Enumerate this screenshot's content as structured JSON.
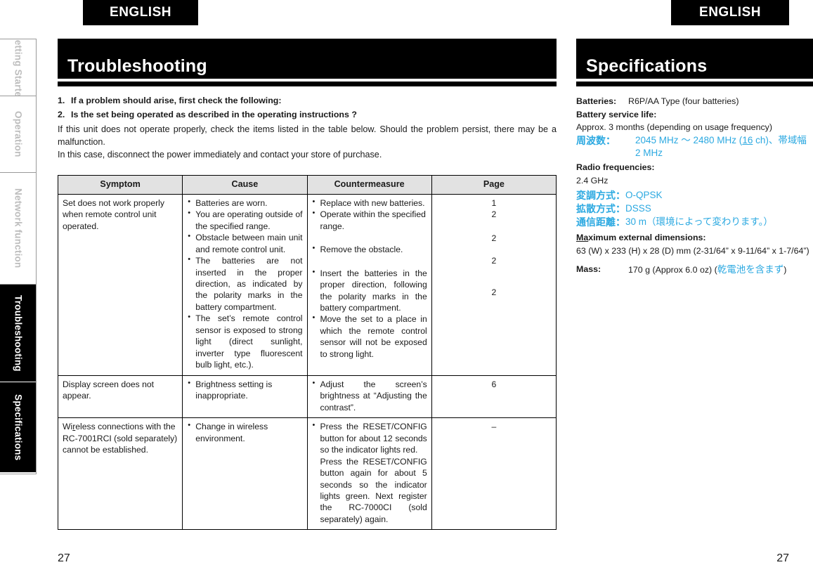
{
  "colors": {
    "accent_blue": "#2ca9e1",
    "header_bg": "#000000",
    "table_header_bg": "#e2e2e2"
  },
  "language_tabs": {
    "left": "ENGLISH",
    "right": "ENGLISH"
  },
  "sidebar": {
    "items": [
      {
        "label": "Getting Started",
        "active": false
      },
      {
        "label": "Operation",
        "active": false
      },
      {
        "label": "Network function",
        "active": false
      },
      {
        "label": "Troubleshooting",
        "active": true
      },
      {
        "label": "Specifications",
        "active": true
      }
    ]
  },
  "main": {
    "title": "Troubleshooting",
    "intro": {
      "item1_num": "1.",
      "item1": "If a problem should arise, first check the following:",
      "item2_num": "2.",
      "item2": "Is the set being operated as described in the operating instructions ?",
      "para1": "If this unit does not operate properly, check the items listed in the table below. Should the problem persist, there may be a malfunction.",
      "para2": "In this case, disconnect the power immediately and contact your store of purchase."
    },
    "table": {
      "headers": [
        "Symptom",
        "Cause",
        "Countermeasure",
        "Page"
      ],
      "rows": [
        {
          "symptom": "Set does not work properly when remote control unit operated.",
          "causes": [
            "Batteries are worn.",
            "You are operating outside of the specified range.",
            "Obstacle between main unit and remote control unit.",
            "The batteries are not inserted in the proper direction, as indicated by the polarity marks in the battery compartment.",
            "The set’s remote control sensor is exposed to strong light (direct sunlight, inverter type fluorescent bulb light, etc.)."
          ],
          "countermeasures": [
            "Replace with new batteries.",
            "Operate within the specified range.",
            "Remove the obstacle.",
            "Insert the batteries in the proper direction, following the polarity marks in the battery compartment.",
            "Move the set to a place in which the remote control sensor will not be exposed to strong light."
          ],
          "pages": [
            "1",
            "2",
            "2",
            "2",
            "2"
          ]
        },
        {
          "symptom": "Display screen does not appear.",
          "causes": [
            "Brightness setting is inappropriate."
          ],
          "countermeasures": [
            "Adjust the screen’s brightness at “Adjusting the contrast”."
          ],
          "pages": [
            "6"
          ]
        },
        {
          "symptom_prefix": "Wi",
          "symptom_underlined": "r",
          "symptom_suffix": "eless connections with the RC-7001RCI (sold separately) cannot be established.",
          "symptom": "Wireless connections with the RC-7001RCI (sold separately) cannot be established.",
          "causes": [
            "Change in wireless environment."
          ],
          "countermeasures": [
            "Press the RESET/CONFIG button for about 12 seconds so the indicator lights red.",
            "Press the RESET/CONFIG button again for about 5 seconds so the indicator lights green. Next register the RC-7000CI (sold separately) again."
          ],
          "pages": [
            "–"
          ]
        }
      ]
    }
  },
  "specs": {
    "title": "Specifications",
    "batteries_label": "Batteries:",
    "batteries_value": "R6P/AA Type (four batteries)",
    "battery_life_label": "Battery service life:",
    "battery_life_value": "Approx. 3 months (depending on usage frequency)",
    "freq_jp_label": "周波数：",
    "freq_jp_value_a": "2045 MHz ～ 2480 MHz (",
    "freq_jp_value_b": "16",
    "freq_jp_value_c": " ch)、帯域幅",
    "freq_jp_value_line2": "2 MHz",
    "radio_label": "Radio frequencies:",
    "radio_value": "2.4 GHz",
    "mod_jp_label": "変調方式：",
    "mod_jp_value": "O-QPSK",
    "spread_jp_label": "拡散方式：",
    "spread_jp_value": "DSSS",
    "range_jp_label": "通信距離：",
    "range_jp_value": "30 m（環境によって変わります。）",
    "dims_label_u": "Ma",
    "dims_label_rest": "ximum external dimensions:",
    "dims_label": "Maximum external dimensions:",
    "dims_value": "63 (W) x 233 (H) x 28 (D) mm (2-31/64” x 9-11/64” x 1-7/64”)",
    "mass_label": "Mass:",
    "mass_value": "170 g (Approx 6.0 oz) (",
    "mass_value_jp": "乾電池を含まず",
    "mass_value_end": ")"
  },
  "page_numbers": {
    "left": "27",
    "right": "27"
  }
}
